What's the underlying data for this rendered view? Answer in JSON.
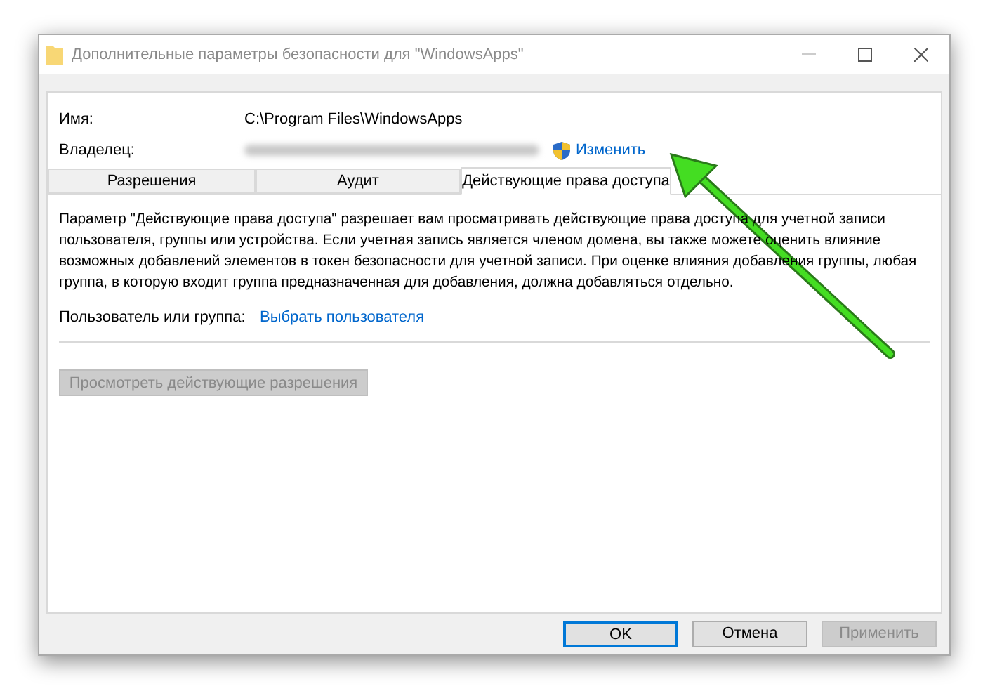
{
  "window": {
    "title": "Дополнительные параметры безопасности  для \"WindowsApps\""
  },
  "name": {
    "label": "Имя:",
    "value": "C:\\Program Files\\WindowsApps"
  },
  "owner": {
    "label": "Владелец:",
    "change_link": "Изменить"
  },
  "tabs": [
    {
      "label": "Разрешения",
      "selected": false
    },
    {
      "label": "Аудит",
      "selected": false
    },
    {
      "label": "Действующие права доступа",
      "selected": true
    }
  ],
  "description": "Параметр \"Действующие права доступа\" разрешает вам просматривать действующие права доступа для учетной записи пользователя, группы или устройства. Если учетная запись является членом домена, вы также можете оценить влияние возможных добавлений элементов в токен безопасности для учетной записи. При оценке влияния добавления группы, любая группа, в которую входит группа предназначенная для добавления, должна добавляться отдельно.",
  "user_or_group": {
    "label": "Пользователь или группа:",
    "link": "Выбрать пользователя"
  },
  "view_button": {
    "label": "Просмотреть действующие разрешения",
    "disabled": true
  },
  "buttons": [
    {
      "label": "OK",
      "default": true,
      "disabled": false
    },
    {
      "label": "Отмена",
      "default": false,
      "disabled": false
    },
    {
      "label": "Применить",
      "default": false,
      "disabled": true
    }
  ]
}
